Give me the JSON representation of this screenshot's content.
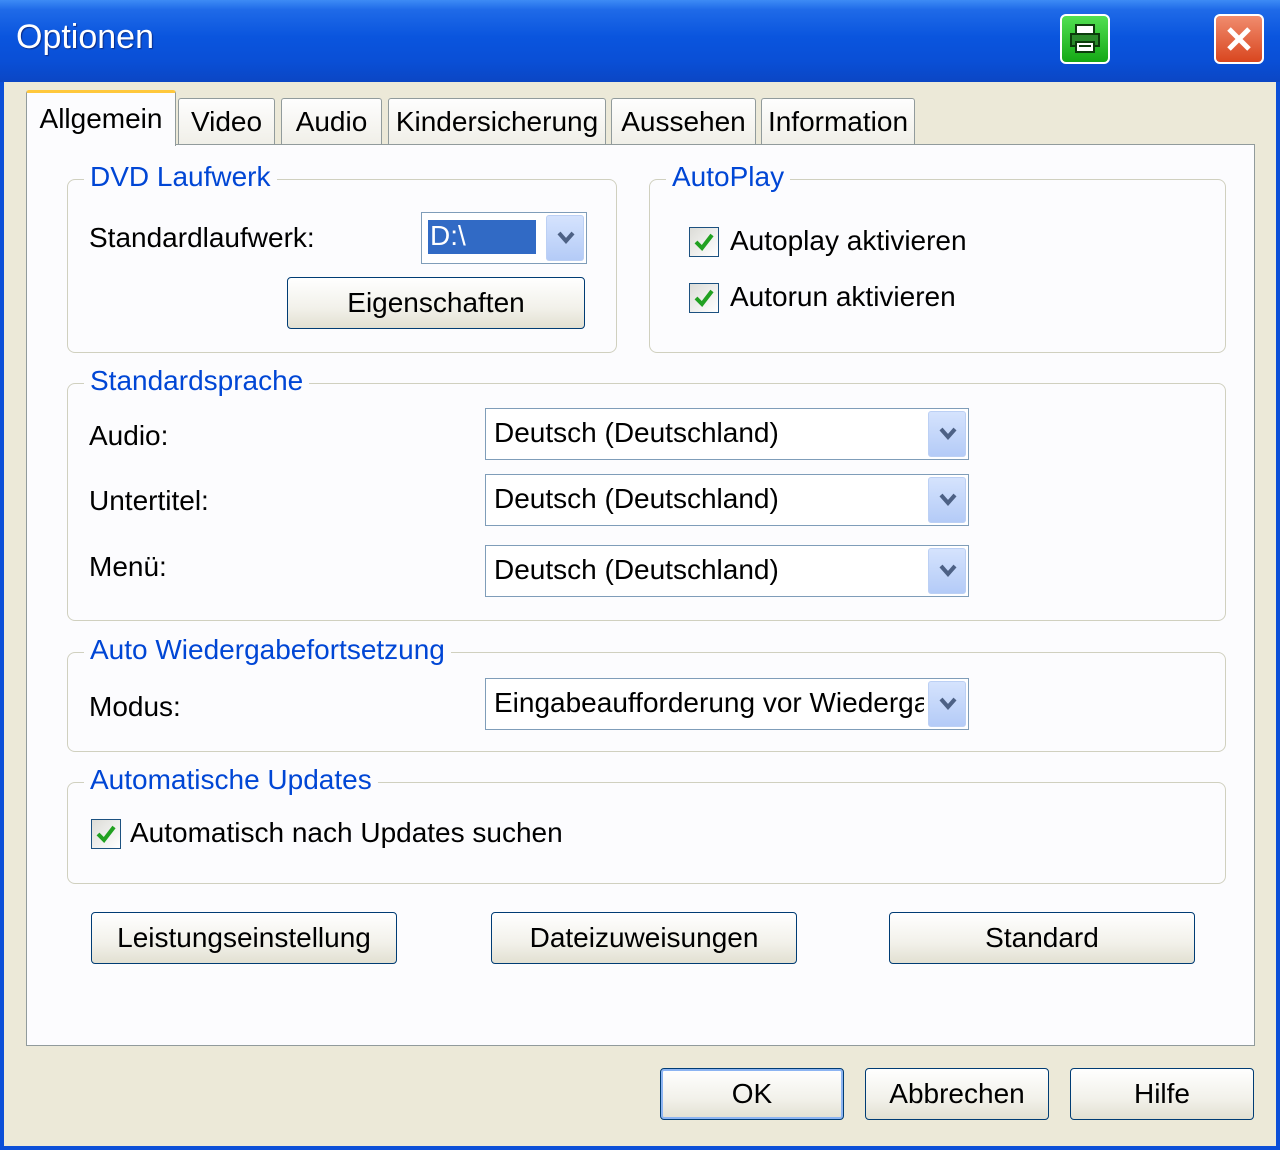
{
  "window": {
    "title": "Optionen"
  },
  "tabs": [
    "Allgemein",
    "Video",
    "Audio",
    "Kindersicherung",
    "Aussehen",
    "Information"
  ],
  "dvd_drive": {
    "legend": "DVD Laufwerk",
    "drive_label": "Standardlaufwerk:",
    "drive_value": "D:\\",
    "properties_button": "Eigenschaften"
  },
  "autoplay": {
    "legend": "AutoPlay",
    "autoplay_label": "Autoplay aktivieren",
    "autoplay_checked": true,
    "autorun_label": "Autorun aktivieren",
    "autorun_checked": true
  },
  "default_language": {
    "legend": "Standardsprache",
    "audio_label": "Audio:",
    "audio_value": "Deutsch (Deutschland)",
    "subtitle_label": "Untertitel:",
    "subtitle_value": "Deutsch (Deutschland)",
    "menu_label": "Menü:",
    "menu_value": "Deutsch (Deutschland)"
  },
  "auto_resume": {
    "legend": "Auto Wiedergabefortsetzung",
    "mode_label": "Modus:",
    "mode_value": "Eingabeaufforderung vor Wiedergal"
  },
  "auto_updates": {
    "legend": "Automatische Updates",
    "check_label": "Automatisch nach Updates suchen",
    "checked": true
  },
  "panel_buttons": {
    "performance": "Leistungseinstellung",
    "file_assoc": "Dateizuweisungen",
    "standard": "Standard"
  },
  "dialog_buttons": {
    "ok": "OK",
    "cancel": "Abbrechen",
    "help": "Hilfe"
  },
  "colors": {
    "titlebar": "#0a55de",
    "legend": "#0046d5",
    "dialog_bg": "#ece9d8",
    "check": "#21a121"
  }
}
